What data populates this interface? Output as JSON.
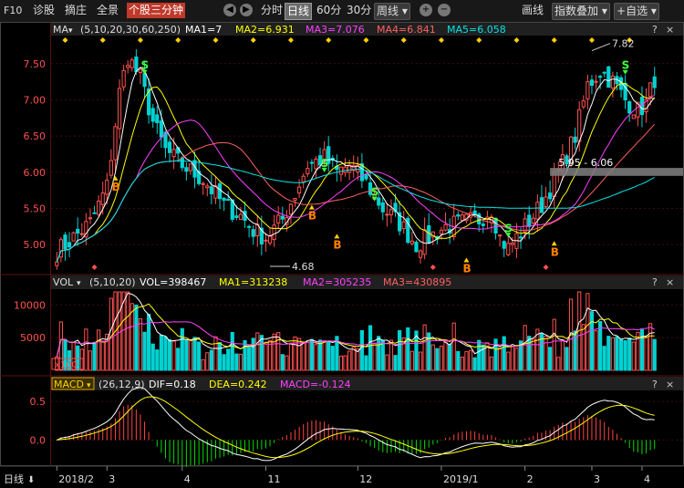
{
  "toolbar": {
    "f10": "F10",
    "items": [
      "诊股",
      "摘庄",
      "全景"
    ],
    "active_tab": "个股三分钟",
    "periods": [
      "分时",
      "日线",
      "60分",
      "30分"
    ],
    "active_period": "日线",
    "week_select": "周线",
    "draw_label": "画线",
    "overlay_label": "指数叠加",
    "custom_label": "自选"
  },
  "colors": {
    "up": "#ff5050",
    "down": "#00d2d2",
    "ma1": "#ffffff",
    "ma2": "#ffff00",
    "ma3": "#ff40ff",
    "ma4": "#ff6060",
    "ma5": "#00e5e5",
    "macd_up": "#ff4444",
    "macd_down": "#00dd00"
  },
  "price_panel": {
    "indicator": "MA",
    "params": "(5,10,20,30,60,250)",
    "ma1": "MA1=7",
    "ma2": "MA2=6.931",
    "ma3": "MA3=7.076",
    "ma4": "MA4=6.841",
    "ma5": "MA5=6.058",
    "annot_high": "7.82",
    "annot_low": "4.68",
    "annot_range": "5.95 - 6.06",
    "buy_mark": "B",
    "sell_mark": "S"
  },
  "vol_panel": {
    "indicator": "VOL",
    "params": "(5,10,20)",
    "vol": "VOL=398467",
    "ma1": "MA1=313238",
    "ma2": "MA2=305235",
    "ma3": "MA3=430895",
    "unit": "x100"
  },
  "macd_panel": {
    "indicator": "MACD",
    "params": "(26,12,9)",
    "dif": "DIF=0.18",
    "dea": "DEA=0.242",
    "macd": "MACD=-0.124"
  },
  "footer": {
    "label": "日线"
  },
  "chart_data": [
    {
      "type": "candlestick",
      "ylim": [
        4.65,
        7.85
      ],
      "yticks": [
        5.0,
        5.5,
        6.0,
        6.5,
        7.0,
        7.5
      ],
      "x_ticks": [
        "2018/2",
        "3",
        "4",
        "11",
        "12",
        "2019/1",
        "2",
        "3",
        "4"
      ],
      "keys": [
        {
          "i": 0,
          "c": 4.9
        },
        {
          "i": 8,
          "c": 5.3
        },
        {
          "i": 12,
          "c": 5.8
        },
        {
          "i": 15,
          "c": 7.1
        },
        {
          "i": 17,
          "c": 7.6
        },
        {
          "i": 20,
          "c": 7.3
        },
        {
          "i": 23,
          "c": 6.7
        },
        {
          "i": 26,
          "c": 6.3
        },
        {
          "i": 30,
          "c": 6.1
        },
        {
          "i": 35,
          "c": 5.9
        },
        {
          "i": 40,
          "c": 5.55
        },
        {
          "i": 44,
          "c": 5.4
        },
        {
          "i": 47,
          "c": 5.2
        },
        {
          "i": 50,
          "c": 5.1
        },
        {
          "i": 54,
          "c": 5.35
        },
        {
          "i": 57,
          "c": 5.7
        },
        {
          "i": 60,
          "c": 6.1
        },
        {
          "i": 64,
          "c": 6.2
        },
        {
          "i": 67,
          "c": 6.0
        },
        {
          "i": 70,
          "c": 6.1
        },
        {
          "i": 74,
          "c": 5.85
        },
        {
          "i": 78,
          "c": 5.5
        },
        {
          "i": 82,
          "c": 5.3
        },
        {
          "i": 86,
          "c": 5.0
        },
        {
          "i": 89,
          "c": 5.1
        },
        {
          "i": 93,
          "c": 5.25
        },
        {
          "i": 97,
          "c": 5.3
        },
        {
          "i": 101,
          "c": 5.35
        },
        {
          "i": 104,
          "c": 5.5
        },
        {
          "i": 106,
          "c": 5.1
        },
        {
          "i": 108,
          "c": 4.95
        },
        {
          "i": 112,
          "c": 5.25
        },
        {
          "i": 116,
          "c": 5.55
        },
        {
          "i": 120,
          "c": 6.0
        },
        {
          "i": 124,
          "c": 6.5
        },
        {
          "i": 127,
          "c": 7.2
        },
        {
          "i": 130,
          "c": 7.4
        },
        {
          "i": 133,
          "c": 7.25
        },
        {
          "i": 136,
          "c": 7.0
        },
        {
          "i": 139,
          "c": 6.85
        },
        {
          "i": 141,
          "c": 6.95
        },
        {
          "i": 143,
          "c": 7.3
        }
      ],
      "n": 144,
      "buy_signals": [
        {
          "i": 14,
          "price": 5.95
        },
        {
          "i": 61,
          "price": 5.55
        },
        {
          "i": 67,
          "price": 5.15
        },
        {
          "i": 98,
          "price": 4.82
        },
        {
          "i": 119,
          "price": 5.05
        }
      ],
      "sell_signals": [
        {
          "i": 21,
          "price": 7.35
        },
        {
          "i": 64,
          "price": 6.0
        },
        {
          "i": 76,
          "price": 5.6
        },
        {
          "i": 108,
          "price": 5.1
        },
        {
          "i": 136,
          "price": 7.35
        }
      ]
    },
    {
      "type": "bar",
      "ylim": [
        0,
        12000
      ],
      "yticks": [
        5000,
        10000
      ],
      "peak_vol": 12000
    },
    {
      "type": "bar",
      "ylim": [
        -0.28,
        0.62
      ],
      "yticks": [
        0.0,
        0.5
      ]
    }
  ]
}
